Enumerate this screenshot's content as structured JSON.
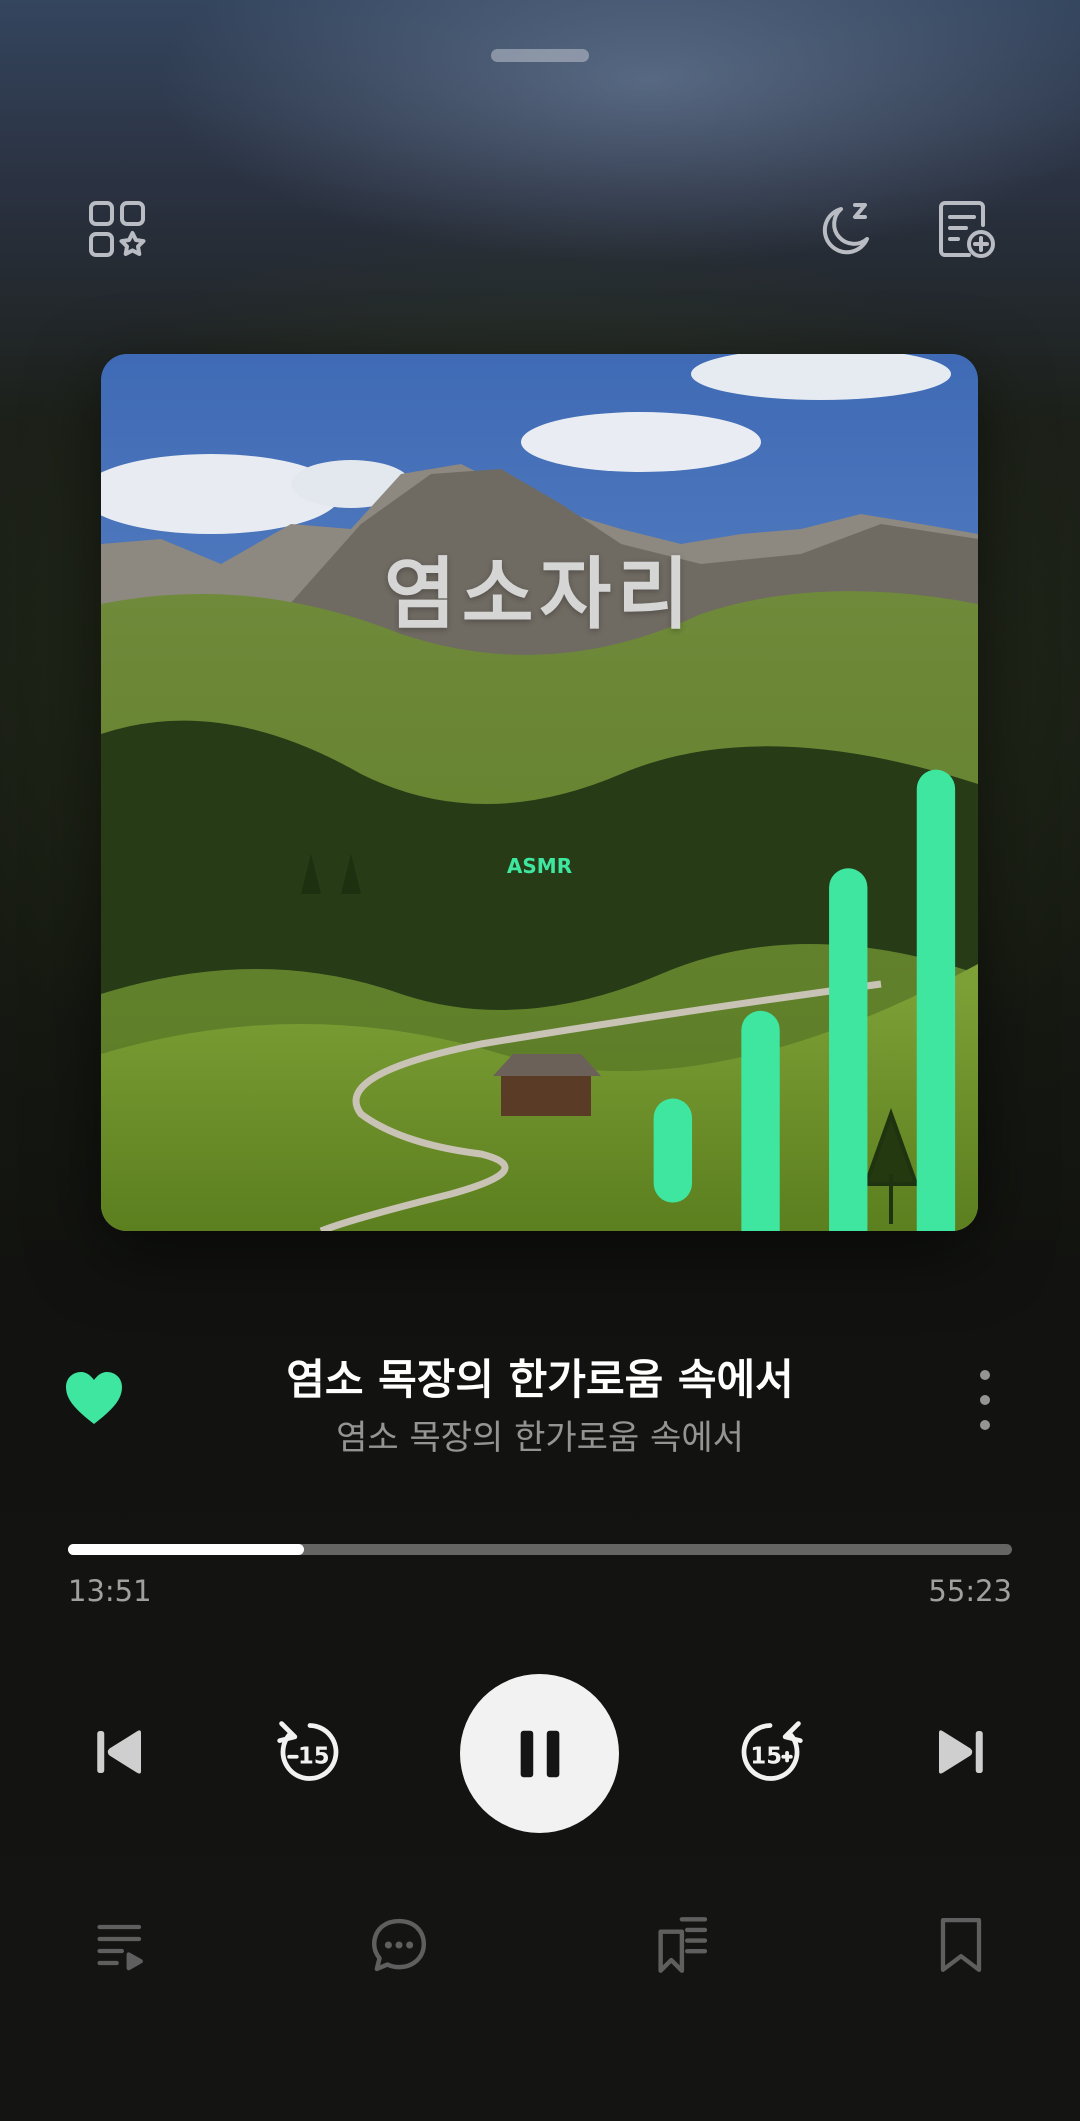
{
  "top_bar": {
    "left_icon": "grid-star-icon",
    "sleep_icon": "sleep-timer-icon",
    "playlist_add_icon": "playlist-add-icon"
  },
  "cover": {
    "title": "염소자리",
    "badge_text": "ASMR"
  },
  "track": {
    "title": "염소 목장의 한가로움 속에서",
    "subtitle": "염소 목장의 한가로움 속에서",
    "liked": true
  },
  "progress": {
    "elapsed": "13:51",
    "total": "55:23",
    "fraction": 0.25
  },
  "controls": {
    "rewind_label": "15",
    "forward_label": "15"
  },
  "bottom_bar": [
    "queue-icon",
    "comment-icon",
    "bookmark-list-icon",
    "bookmark-icon"
  ],
  "colors": {
    "accent": "#3ee6a0",
    "text_primary": "#ffffff",
    "text_secondary": "#8f8f8f"
  }
}
